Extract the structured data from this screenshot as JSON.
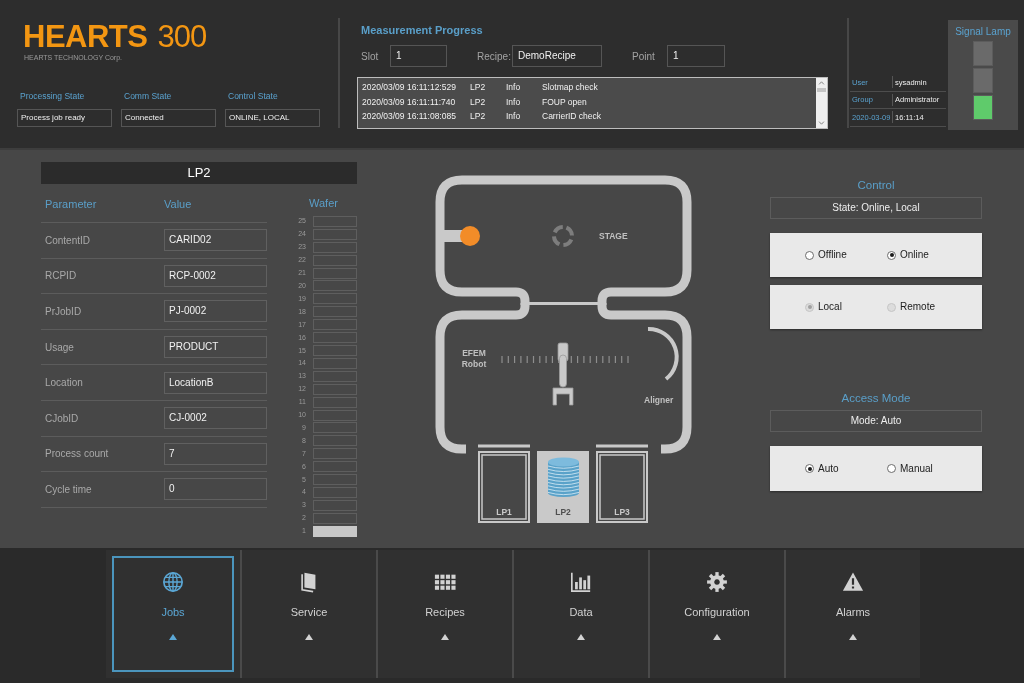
{
  "header": {
    "logo": {
      "name": "HEARTS",
      "model": "300"
    },
    "company": "HEARTS TECHNOLOGY Corp.",
    "states": [
      {
        "label": "Processing State",
        "value": "Process job ready"
      },
      {
        "label": "Comm State",
        "value": "Connected"
      },
      {
        "label": "Control State",
        "value": "ONLINE, LOCAL"
      }
    ]
  },
  "measurement_progress": {
    "title": "Measurement Progress",
    "fields": [
      {
        "label": "Slot",
        "value": "1"
      },
      {
        "label": "Recipe:",
        "value": "DemoRecipe"
      },
      {
        "label": "Point",
        "value": "1"
      }
    ],
    "log": [
      {
        "time": "2020/03/09 16:11:12:529",
        "port": "LP2",
        "level": "Info",
        "message": "Slotmap check"
      },
      {
        "time": "2020/03/09 16:11:11:740",
        "port": "LP2",
        "level": "Info",
        "message": "FOUP open"
      },
      {
        "time": "2020/03/09 16:11:08:085",
        "port": "LP2",
        "level": "Info",
        "message": "CarrierID check"
      }
    ]
  },
  "user_info": [
    {
      "label": "User",
      "value": "sysadmin"
    },
    {
      "label": "Group",
      "value": "Administrator"
    },
    {
      "label": "2020-03-09",
      "value": "16:11:14"
    }
  ],
  "signal_lamp": {
    "title": "Signal Lamp",
    "lamps": [
      {
        "on": false
      },
      {
        "on": false
      },
      {
        "on": true,
        "color": "#5fcb6b"
      }
    ]
  },
  "load_port_panel": {
    "title": "LP2",
    "columns": [
      "Parameter",
      "Value"
    ],
    "rows": [
      {
        "parameter": "ContentID",
        "value": "CARID02"
      },
      {
        "parameter": "RCPID",
        "value": "RCP-0002"
      },
      {
        "parameter": "PrJobID",
        "value": "PJ-0002"
      },
      {
        "parameter": "Usage",
        "value": "PRODUCT"
      },
      {
        "parameter": "Location",
        "value": "LocationB"
      },
      {
        "parameter": "CJobID",
        "value": "CJ-0002"
      },
      {
        "parameter": "Process count",
        "value": "7"
      },
      {
        "parameter": "Cycle time",
        "value": "0"
      }
    ],
    "wafer_title": "Wafer",
    "slots": [
      {
        "label": "25",
        "occupied": false
      },
      {
        "label": "24",
        "occupied": false
      },
      {
        "label": "23",
        "occupied": false
      },
      {
        "label": "22",
        "occupied": false
      },
      {
        "label": "21",
        "occupied": false
      },
      {
        "label": "20",
        "occupied": false
      },
      {
        "label": "19",
        "occupied": false
      },
      {
        "label": "18",
        "occupied": false
      },
      {
        "label": "17",
        "occupied": false
      },
      {
        "label": "16",
        "occupied": false
      },
      {
        "label": "15",
        "occupied": false
      },
      {
        "label": "14",
        "occupied": false
      },
      {
        "label": "13",
        "occupied": false
      },
      {
        "label": "12",
        "occupied": false
      },
      {
        "label": "11",
        "occupied": false
      },
      {
        "label": "10",
        "occupied": false
      },
      {
        "label": "9",
        "occupied": false
      },
      {
        "label": "8",
        "occupied": false
      },
      {
        "label": "7",
        "occupied": false
      },
      {
        "label": "6",
        "occupied": false
      },
      {
        "label": "5",
        "occupied": false
      },
      {
        "label": "4",
        "occupied": false
      },
      {
        "label": "3",
        "occupied": false
      },
      {
        "label": "2",
        "occupied": false
      },
      {
        "label": "1",
        "occupied": true
      }
    ]
  },
  "equipment_map": {
    "stage_label": "STAGE",
    "robot_label": "EFEM Robot",
    "aligner_label": "Aligner",
    "load_ports": [
      {
        "label": "LP1",
        "selected": false,
        "carrier": false
      },
      {
        "label": "LP2",
        "selected": true,
        "carrier": true
      },
      {
        "label": "LP3",
        "selected": false,
        "carrier": false
      }
    ]
  },
  "control": {
    "title": "Control",
    "state": "State: Online, Local",
    "groups": [
      {
        "disabled": false,
        "options": [
          {
            "label": "Offline",
            "selected": false
          },
          {
            "label": "Online",
            "selected": true
          }
        ]
      },
      {
        "disabled": true,
        "options": [
          {
            "label": "Local",
            "selected": true
          },
          {
            "label": "Remote",
            "selected": false
          }
        ]
      }
    ]
  },
  "access_mode": {
    "title": "Access Mode",
    "state": "Mode: Auto",
    "groups": [
      {
        "disabled": false,
        "options": [
          {
            "label": "Auto",
            "selected": true
          },
          {
            "label": "Manual",
            "selected": false
          }
        ]
      }
    ]
  },
  "nav": [
    {
      "label": "Jobs",
      "selected": true
    },
    {
      "label": "Service",
      "selected": false
    },
    {
      "label": "Recipes",
      "selected": false
    },
    {
      "label": "Data",
      "selected": false
    },
    {
      "label": "Configuration",
      "selected": false
    },
    {
      "label": "Alarms",
      "selected": false
    }
  ]
}
